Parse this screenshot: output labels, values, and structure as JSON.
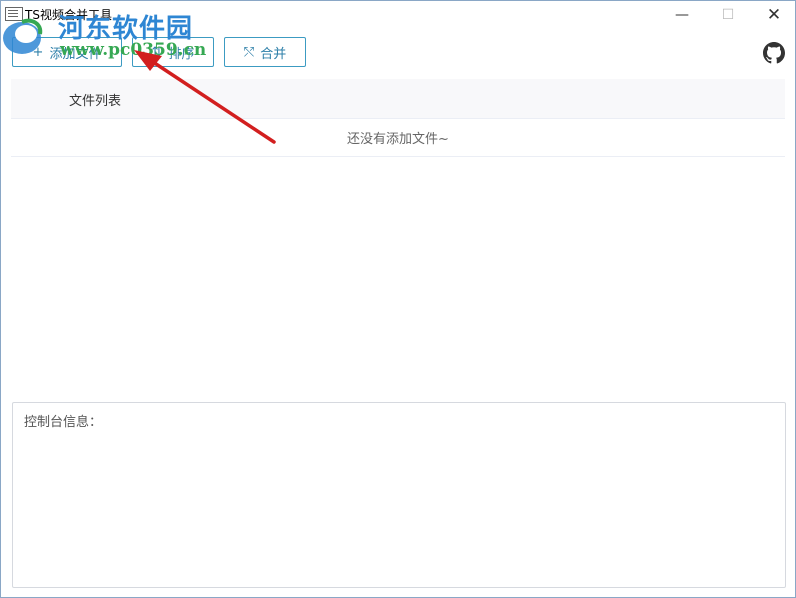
{
  "window": {
    "title": "TS视频合并工具",
    "minimize_glyph": "—",
    "maximize_glyph": "☐",
    "close_glyph": "✕"
  },
  "watermark": {
    "site_name": "河东软件园",
    "url": "www.pc0359.cn",
    "title_color": "#2e86d3",
    "url_color": "#36a853"
  },
  "toolbar": {
    "add_label": "添加文件",
    "add_icon": "plus-icon",
    "sort_label": "排序",
    "sort_icon": "sort-icon",
    "merge_label": "合并",
    "merge_icon": "merge-icon",
    "accent_color": "#3c9bc2"
  },
  "file_table": {
    "columns": [
      "文件列表"
    ],
    "empty_text": "还没有添加文件~"
  },
  "console": {
    "label": "控制台信息："
  },
  "annotation": {
    "arrow_color": "#d21f1f"
  }
}
